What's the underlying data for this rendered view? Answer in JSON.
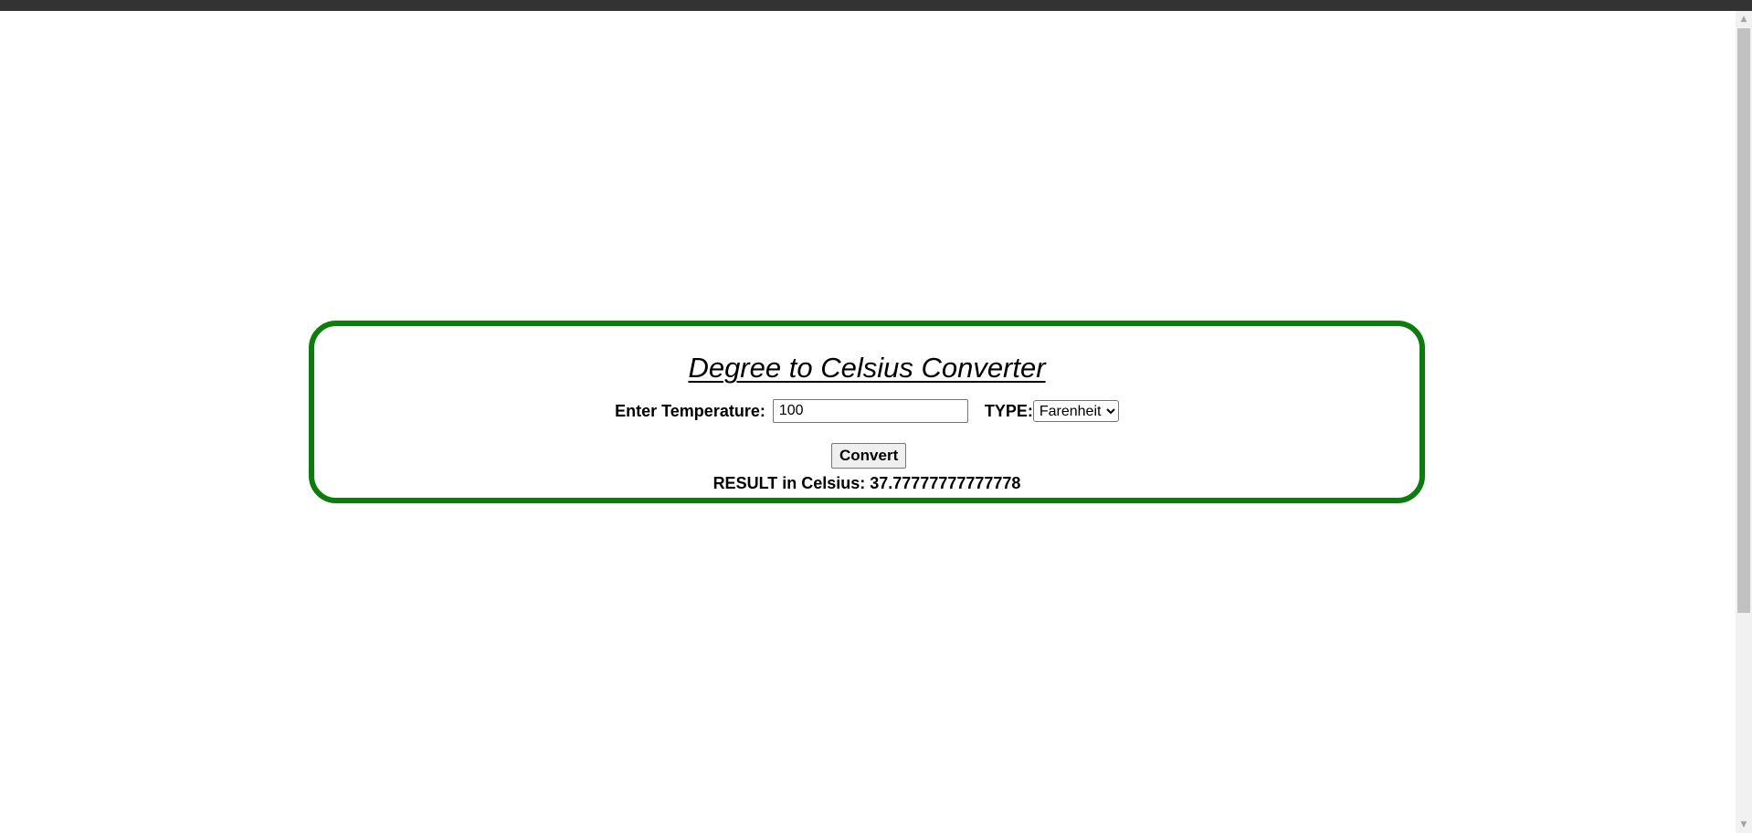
{
  "page": {
    "title": "Degree to Celsius Converter"
  },
  "form": {
    "temperature_label": "Enter Temperature:",
    "temperature_value": "100",
    "type_label": "TYPE:",
    "type_selected": "Farenheit",
    "convert_label": "Convert",
    "result_text": "RESULT in Celsius: 37.77777777777778"
  },
  "colors": {
    "box_border": "#0b7d0b",
    "browser_bar": "#333333"
  },
  "icons": {
    "scroll_up": "triangle-up-icon",
    "scroll_down": "triangle-down-icon",
    "select_arrow": "chevron-down-icon"
  }
}
